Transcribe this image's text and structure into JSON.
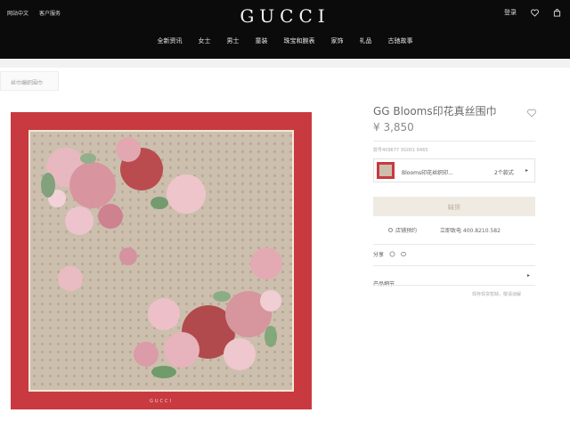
{
  "header": {
    "top_links": [
      "网站中文",
      "客户服务"
    ],
    "logo": "GUCCI",
    "login": "登录",
    "nav": [
      "全新资讯",
      "女士",
      "男士",
      "童装",
      "珠宝和腕表",
      "家饰",
      "礼品",
      "古驰故事"
    ]
  },
  "breadcrumb": "丝巾编织围巾",
  "product": {
    "title": "GG Blooms印花真丝围巾",
    "price": "¥ 3,850",
    "sku": "款号409677 3G001 6465",
    "variant_name": "Blooms印花丝织印...",
    "variant_count": "2个款式",
    "variant_arrow": "▸",
    "cta": "缺货",
    "store_link": "店铺预约",
    "phone": "立即致电 400.8210.582",
    "share_label": "分享",
    "details_label": "产品细节",
    "details_arrow": "▸",
    "note": "现存现货暂缺，敬请谅解",
    "scarf_mark": "GUCCI"
  },
  "colors": {
    "scarf_border": "#c83a3f",
    "header_bg": "#0b0b0b",
    "cta_bg": "#efebe3"
  }
}
